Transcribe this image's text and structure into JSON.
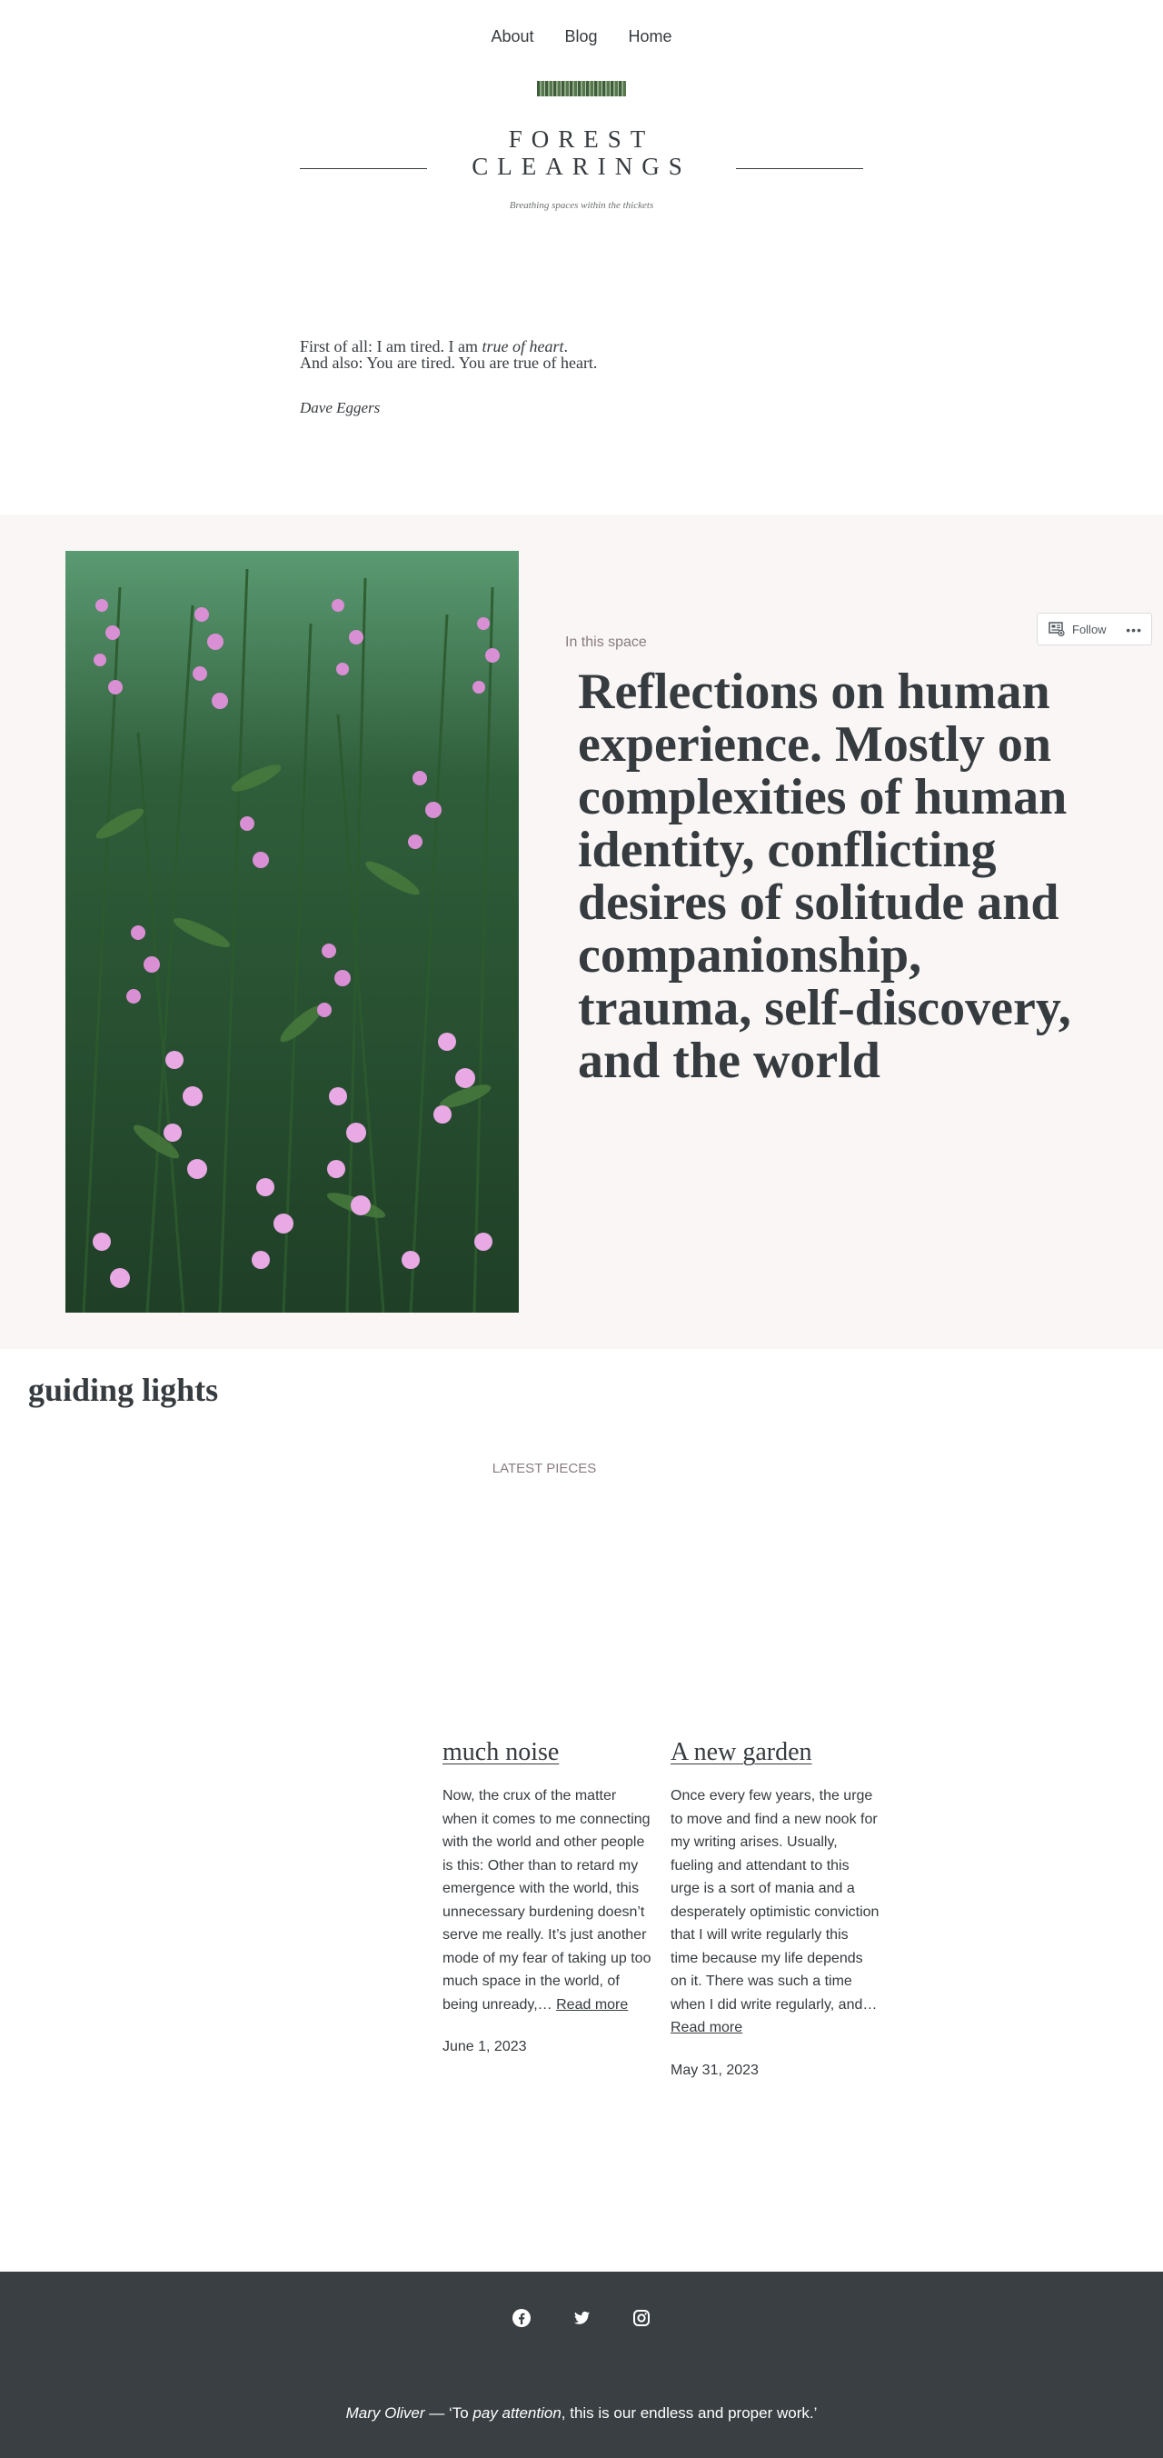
{
  "nav": {
    "items": [
      {
        "label": "About"
      },
      {
        "label": "Blog"
      },
      {
        "label": "Home"
      }
    ]
  },
  "site": {
    "title": "FOREST CLEARINGS",
    "title_line1": "FOREST",
    "title_line2": "CLEARINGS",
    "tagline": "Breathing spaces within the thickets"
  },
  "quote": {
    "line1_a": "First of all: I am tired. I am ",
    "line1_em": "true of heart",
    "line1_b": ".",
    "line2": "And also: You are tired. You are true of heart.",
    "author": "Dave Eggers"
  },
  "hero": {
    "kicker": "In this space",
    "heading": "Reflections on human experience. Mostly on complexities of human identity, conflicting desires of solitude and companionship, trauma, self-discovery, and the world"
  },
  "follow": {
    "label": "Follow",
    "more": "•••"
  },
  "section": {
    "title": "guiding lights",
    "latest": "LATEST PIECES"
  },
  "posts": [
    {
      "title": "much noise",
      "excerpt": "Now, the crux of the matter when it comes to me connecting with the world and other people is this: Other than to retard my emergence with the world, this unnecessary burdening doesn’t serve me really. It’s just another mode of my fear of taking up too much space in the world, of being unready,…",
      "read_more": "Read more",
      "date": "June 1, 2023"
    },
    {
      "title": "A new garden",
      "excerpt": "Once every few years, the urge to move and find a new nook for my writing arises. Usually, fueling and attendant to this urge is a sort of mania and a desperately optimistic conviction that I will write regularly this time because my life depends on it. There was such a time when I did write regularly, and…",
      "read_more": "Read more",
      "date": "May 31, 2023"
    }
  ],
  "footer": {
    "social_icons": [
      "facebook-icon",
      "twitter-icon",
      "instagram-icon"
    ],
    "quote_author": "Mary Oliver",
    "quote_sep": " — ‘To ",
    "quote_em": "pay attention",
    "quote_rest": ", this is our endless and proper work.’"
  },
  "colors": {
    "text": "#363b3f",
    "hero_bg": "#f9f6f5",
    "footer_bg": "#393f42",
    "muted": "#8a7c80"
  }
}
